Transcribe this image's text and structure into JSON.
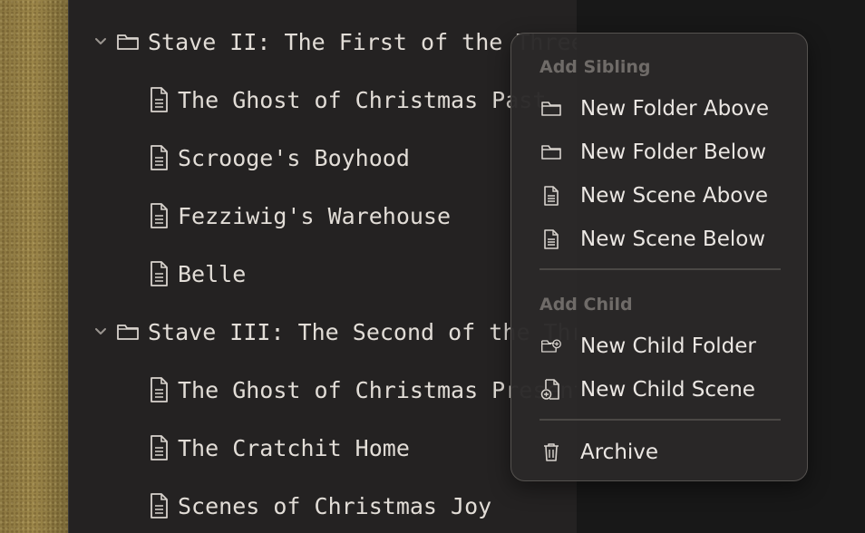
{
  "outline": {
    "rows": [
      {
        "kind": "folder",
        "title": "Stave II: The First of the Three Spirits",
        "expanded": true,
        "selected": true
      },
      {
        "kind": "scene",
        "title": "The Ghost of Christmas Past"
      },
      {
        "kind": "scene",
        "title": "Scrooge's Boyhood"
      },
      {
        "kind": "scene",
        "title": "Fezziwig's Warehouse"
      },
      {
        "kind": "scene",
        "title": "Belle"
      },
      {
        "kind": "folder",
        "title": "Stave III: The Second of the Three Spirits",
        "expanded": true
      },
      {
        "kind": "scene",
        "title": "The Ghost of Christmas Present"
      },
      {
        "kind": "scene",
        "title": "The Cratchit Home"
      },
      {
        "kind": "scene",
        "title": "Scenes of Christmas Joy"
      }
    ]
  },
  "context_menu": {
    "sibling_header": "Add Sibling",
    "new_folder_above": "New Folder Above",
    "new_folder_below": "New Folder Below",
    "new_scene_above": "New Scene Above",
    "new_scene_below": "New Scene Below",
    "child_header": "Add Child",
    "new_child_folder": "New Child Folder",
    "new_child_scene": "New Child Scene",
    "archive": "Archive"
  },
  "colors": {
    "selection_outline": "#2c6dd8",
    "text": "#e2ddd7",
    "menu_header": "#6f6b68"
  }
}
